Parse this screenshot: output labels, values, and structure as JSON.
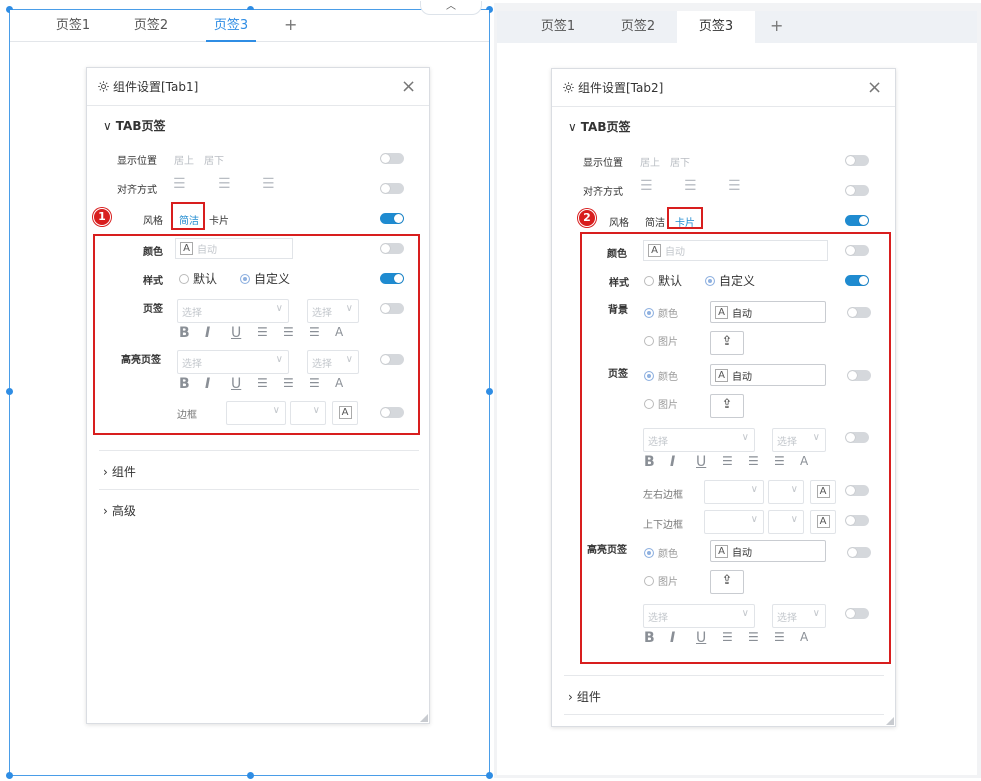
{
  "tabs": [
    "页签1",
    "页签2",
    "页签3"
  ],
  "collapse_glyph": "︿",
  "plus_glyph": "+",
  "left_panel": {
    "title": "组件设置[Tab1]",
    "section_tab": "TAB页签",
    "rows": {
      "position": {
        "label": "显示位置",
        "opt1": "居上",
        "opt2": "居下"
      },
      "align": {
        "label": "对齐方式"
      },
      "style": {
        "label": "风格",
        "opt1": "简洁",
        "opt2": "卡片"
      },
      "color": {
        "label": "颜色",
        "value": "自动"
      },
      "mode": {
        "label": "样式",
        "opt1": "默认",
        "opt2": "自定义"
      },
      "tab": {
        "label": "页签",
        "placeholder1": "选择",
        "placeholder2": "选择"
      },
      "hl": {
        "label": "高亮页签",
        "placeholder1": "选择",
        "placeholder2": "选择"
      },
      "border": {
        "label": "边框"
      }
    },
    "section_component": "组件",
    "section_advanced": "高级",
    "badge": "1"
  },
  "right_panel": {
    "title": "组件设置[Tab2]",
    "section_tab": "TAB页签",
    "rows": {
      "position": {
        "label": "显示位置",
        "opt1": "居上",
        "opt2": "居下"
      },
      "align": {
        "label": "对齐方式"
      },
      "style": {
        "label": "风格",
        "opt1": "简洁",
        "opt2": "卡片"
      },
      "color": {
        "label": "颜色",
        "value": "自动"
      },
      "mode": {
        "label": "样式",
        "opt1": "默认",
        "opt2": "自定义"
      },
      "bg": {
        "label": "背景",
        "opt1": "颜色",
        "opt2": "图片",
        "value": "自动"
      },
      "tab": {
        "label": "页签",
        "opt1": "颜色",
        "opt2": "图片",
        "value": "自动",
        "placeholder1": "选择",
        "placeholder2": "选择"
      },
      "lr_border": {
        "label": "左右边框"
      },
      "tb_border": {
        "label": "上下边框"
      },
      "hl": {
        "label": "高亮页签",
        "opt1": "颜色",
        "opt2": "图片",
        "value": "自动",
        "placeholder1": "选择",
        "placeholder2": "选择"
      }
    },
    "section_component": "组件",
    "badge": "2"
  },
  "fmt": {
    "bold": "B",
    "italic": "I",
    "underline": "U",
    "color": "A"
  }
}
